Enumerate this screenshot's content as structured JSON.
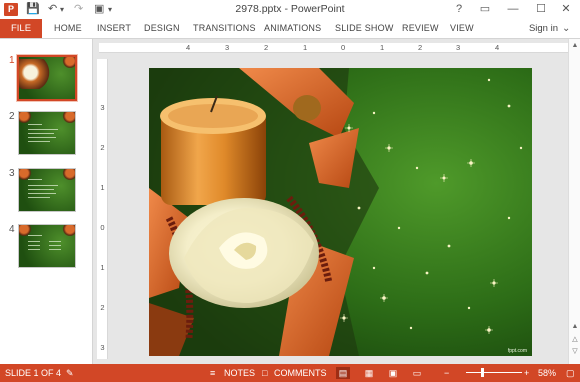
{
  "window": {
    "title": "2978.pptx - PowerPoint",
    "app_icon": "P",
    "quick_access": [
      "save-icon",
      "undo-icon",
      "redo-icon",
      "present-icon"
    ],
    "controls": {
      "help": "?",
      "ribbon": "▭",
      "minimize": "—",
      "maximize": "☐",
      "close": "✕"
    }
  },
  "ribbon": {
    "file_label": "FILE",
    "tabs": [
      "HOME",
      "INSERT",
      "DESIGN",
      "TRANSITIONS",
      "ANIMATIONS",
      "SLIDE SHOW",
      "REVIEW",
      "VIEW"
    ],
    "signin_label": "Sign in"
  },
  "thumbnails": [
    {
      "number": "1",
      "active": true
    },
    {
      "number": "2",
      "active": false
    },
    {
      "number": "3",
      "active": false
    },
    {
      "number": "4",
      "active": false
    }
  ],
  "ruler": {
    "horizontal": [
      "4",
      "3",
      "2",
      "1",
      "0",
      "1",
      "2",
      "3",
      "4"
    ],
    "vertical": [
      "3",
      "2",
      "1",
      "0",
      "1",
      "2",
      "3"
    ]
  },
  "slide": {
    "watermark": "fppt.com"
  },
  "statusbar": {
    "slide_info": "SLIDE 1 OF 4",
    "notes_label": "NOTES",
    "comments_label": "COMMENTS",
    "zoom_minus": "−",
    "zoom_plus": "+",
    "zoom_level": "58%",
    "zoom_fraction": 0.58
  },
  "colors": {
    "accent": "#d24726",
    "slide_bg": "#235a12"
  }
}
